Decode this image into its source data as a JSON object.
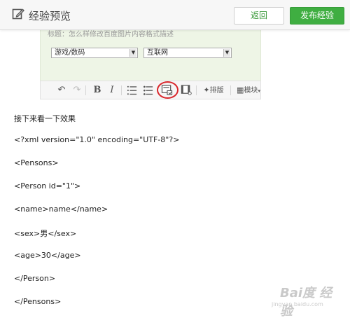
{
  "header": {
    "title": "经验预览",
    "back_label": "返回",
    "publish_label": "发布经验",
    "accent": "#3fae41"
  },
  "panel": {
    "title_text": "标题：怎么样修改百度图片内容格式描述",
    "category": "游戏/数码",
    "subcategory": "互联网",
    "background": "#eef5e6"
  },
  "toolbar": {
    "undo_icon": "↶",
    "redo_icon": "↷",
    "bold": "B",
    "italic": "I",
    "ordered_list_icon": "☰",
    "unordered_list_icon": "☰",
    "code_icon": "⊡",
    "media_icon": "▤",
    "layout_label": "排版",
    "module_label": "模块"
  },
  "content": {
    "lines": [
      "接下来看一下效果",
      "<?xml version=\"1.0\" encoding=\"UTF-8\"?>",
      "<Pensons>",
      "<Person id=\"1\">",
      "<name>name</name>",
      "<sex>男</sex>",
      "<age>30</age>",
      "</Person>",
      "</Pensons>"
    ]
  },
  "watermark": {
    "text": "Bai度 经验",
    "url": "jingyan.baidu.com"
  }
}
